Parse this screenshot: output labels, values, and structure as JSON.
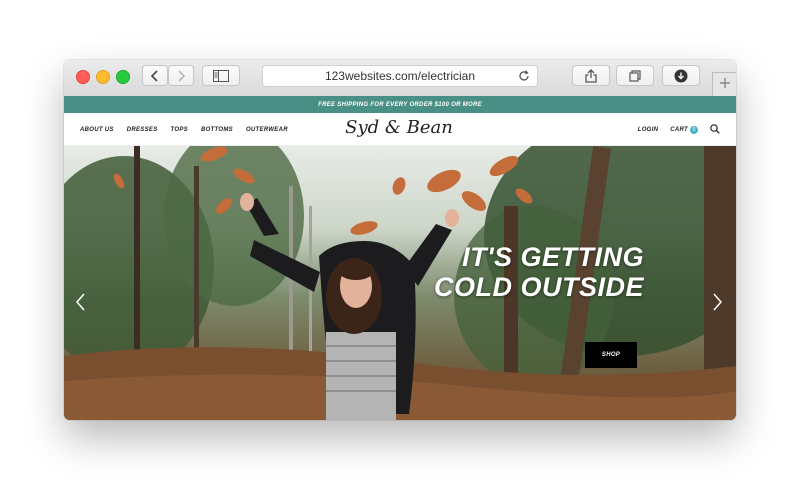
{
  "browser": {
    "url": "123websites.com/electrician"
  },
  "promo": {
    "text": "FREE SHIPPING FOR EVERY ORDER $100 OR MORE"
  },
  "nav": {
    "links": [
      "ABOUT US",
      "DRESSES",
      "TOPS",
      "BOTTOMS",
      "OUTERWEAR"
    ],
    "logo": "Syd & Bean",
    "login": "LOGIN",
    "cart": "CART",
    "cart_count": "0"
  },
  "hero": {
    "headline_line1": "IT'S GETTING",
    "headline_line2": "COLD OUTSIDE",
    "cta": "SHOP"
  },
  "icons": {
    "back": "chevron-left-icon",
    "forward": "chevron-right-icon",
    "sidebar": "sidebar-icon",
    "reload": "reload-icon",
    "share": "share-icon",
    "tabs": "tabs-icon",
    "downloads": "download-icon",
    "new_tab": "plus-icon",
    "search": "search-icon"
  },
  "colors": {
    "promo_bar": "#4a8f85",
    "cta": "#000000"
  }
}
